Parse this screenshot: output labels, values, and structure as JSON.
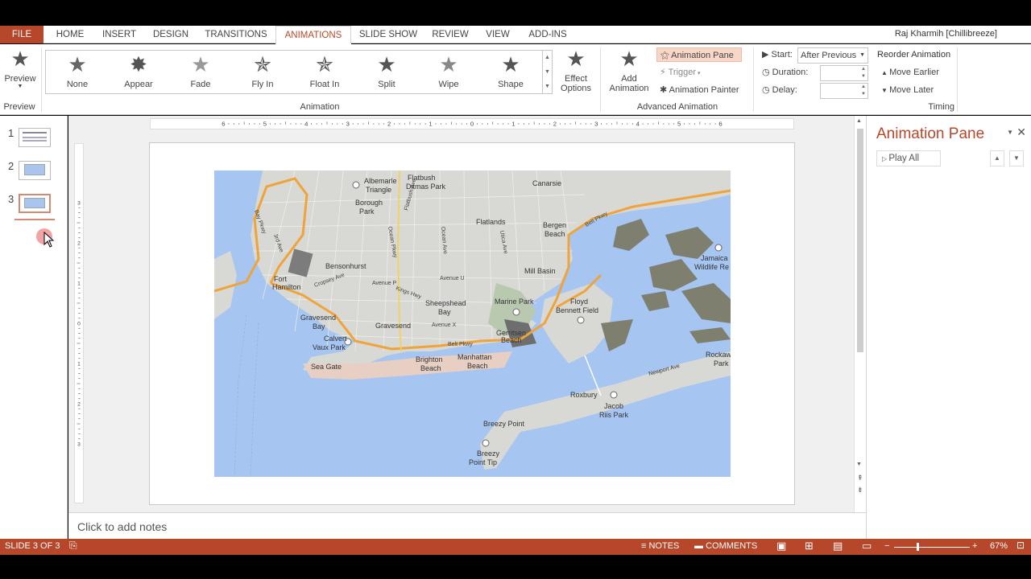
{
  "ribbon_tabs": [
    "FILE",
    "HOME",
    "INSERT",
    "DESIGN",
    "TRANSITIONS",
    "ANIMATIONS",
    "SLIDE SHOW",
    "REVIEW",
    "VIEW",
    "ADD-INS"
  ],
  "user_name": "Raj Kharmih [Chillibreeze]",
  "preview": {
    "label": "Preview",
    "group_label": "Preview"
  },
  "animation_gallery": {
    "group_label": "Animation",
    "items": [
      "None",
      "Appear",
      "Fade",
      "Fly In",
      "Float In",
      "Split",
      "Wipe",
      "Shape"
    ]
  },
  "effect_options": {
    "label_line1": "Effect",
    "label_line2": "Options"
  },
  "advanced": {
    "group_label": "Advanced Animation",
    "add_animation_line1": "Add",
    "add_animation_line2": "Animation",
    "animation_pane": "Animation Pane",
    "trigger": "Trigger",
    "animation_painter": "Animation Painter"
  },
  "timing": {
    "group_label": "Timing",
    "start_label": "Start:",
    "start_value": "After Previous",
    "duration_label": "Duration:",
    "delay_label": "Delay:"
  },
  "reorder": {
    "title": "Reorder Animation",
    "move_earlier": "Move Earlier",
    "move_later": "Move Later"
  },
  "slides": [
    {
      "number": "1"
    },
    {
      "number": "2"
    },
    {
      "number": "3"
    }
  ],
  "ruler_h": [
    "6",
    "5",
    "4",
    "3",
    "2",
    "1",
    "0",
    "1",
    "2",
    "3",
    "4",
    "5",
    "6"
  ],
  "ruler_v": [
    "3",
    "2",
    "1",
    "0",
    "1",
    "2",
    "3"
  ],
  "map_labels": {
    "albemarle": "Albemarle",
    "triangle": "Triangle",
    "flatbush": "Flatbush",
    "ditmas": "Ditmas Park",
    "canarsie": "Canarsie",
    "borough": "Borough",
    "park": "Park",
    "flatlands": "Flatlands",
    "bergen": "Bergen",
    "beach": "Beach",
    "bensonhurst": "Bensonhurst",
    "mill_basin": "Mill Basin",
    "fort": "Fort",
    "hamilton": "Hamilton",
    "sheepshead": "Sheepshead",
    "bay": "Bay",
    "marine_park": "Marine Park",
    "floyd": "Floyd",
    "bennett": "Bennett Field",
    "gravesend_bay": "Gravesend",
    "gravesend_bay2": "Bay",
    "gravesend": "Gravesend",
    "gerritsen": "Gerritsen",
    "gerritsen2": "Beach",
    "calvert": "Calvert",
    "vaux": "Vaux Park",
    "brighton": "Brighton",
    "brighton2": "Beach",
    "manhattan": "Manhattan",
    "manhattan2": "Beach",
    "sea_gate": "Sea Gate",
    "jamaica": "Jamaica",
    "wildlife": "Wildlife Re",
    "rockaway": "Rockaway",
    "rockaway2": "Park",
    "newport": "Newport Ave",
    "roxbury": "Roxbury",
    "jacob": "Jacob",
    "riis": "Riis Park",
    "breezy": "Breezy Point",
    "breezy_tip1": "Breezy",
    "breezy_tip2": "Point Tip",
    "avenue_p": "Avenue P",
    "avenue_u": "Avenue U",
    "avenue_x": "Avenue X",
    "belt_pkwy": "Belt Pkwy",
    "bay_pkwy": "Bay Pkwy",
    "ocean_pkwy": "Ocean Pkwy",
    "ocean_ave": "Ocean Ave",
    "flatbush_ave": "Flatbush Ave",
    "utica_ave": "Utica Ave",
    "kings_hwy": "Kings Hwy",
    "cropsey": "Cropsey Ave",
    "third_ave": "3rd Ave",
    "bay_pky2": "Belt Pkwy"
  },
  "notes_placeholder": "Click to add notes",
  "animation_pane": {
    "title": "Animation Pane",
    "play_all": "Play All"
  },
  "status": {
    "slide_info": "SLIDE 3 OF 3",
    "notes": "NOTES",
    "comments": "COMMENTS",
    "zoom": "67%"
  }
}
